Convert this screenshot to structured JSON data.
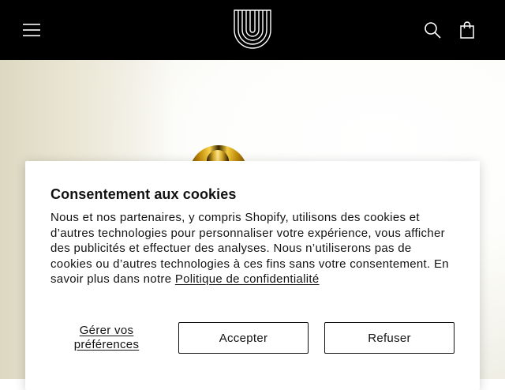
{
  "header": {
    "background": "#000000",
    "icons": {
      "menu": "hamburger-menu-icon",
      "logo": "brand-logo",
      "search": "search-icon",
      "cart": "shopping-bag-icon"
    }
  },
  "cookie_banner": {
    "title": "Consentement aux cookies",
    "body": "Nous et nos partenaires, y compris Shopify, utilisons des cookies et d’autres technologies pour personnaliser votre expérience, vous afficher des publicités et effectuer des analyses. Nous n’utiliserons pas de cookies ou d’autres technologies à ces fins sans votre consentement. En savoir plus dans notre ",
    "policy_link": "Politique de confidentialité",
    "manage_label": "Gérer vos préférences",
    "accept_label": "Accepter",
    "refuse_label": "Refuser"
  }
}
